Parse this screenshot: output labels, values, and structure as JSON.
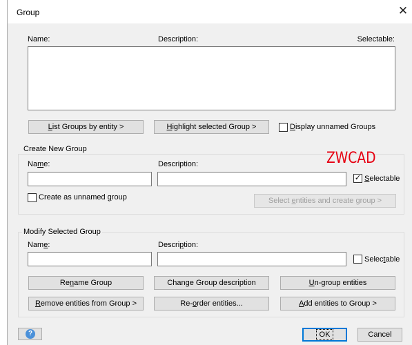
{
  "window": {
    "title": "Group",
    "close_glyph": "✕"
  },
  "groups_list": {
    "col_name": "Name:",
    "col_description": "Description:",
    "col_selectable": "Selectable:",
    "rows": []
  },
  "top_buttons": {
    "list_by_entity_pre": "",
    "list_by_entity_u": "L",
    "list_by_entity_post": "ist Groups by entity  >",
    "highlight_pre": "",
    "highlight_u": "H",
    "highlight_post": "ighlight selected Group  >",
    "display_unnamed_pre": "",
    "display_unnamed_u": "D",
    "display_unnamed_post": "isplay unnamed Groups",
    "display_unnamed_checked": false
  },
  "create_group": {
    "title": "Create New Group",
    "name_pre": "Na",
    "name_u": "m",
    "name_post": "e:",
    "description_label": "Description:",
    "name_value": "",
    "description_value": "",
    "selectable_pre": "",
    "selectable_u": "S",
    "selectable_post": "electable",
    "selectable_checked": true,
    "unnamed_pre": "Create as unnamed ",
    "unnamed_u": "g",
    "unnamed_post": "roup",
    "unnamed_checked": false,
    "select_entities_pre": "Select ",
    "select_entities_u": "e",
    "select_entities_post": "ntities and create group  >"
  },
  "watermark": "ZWCAD",
  "modify_group": {
    "title": "Modify Selected Group",
    "name_pre": "Nam",
    "name_u": "e",
    "name_post": ":",
    "description_pre": "Descri",
    "description_u": "p",
    "description_post": "tion:",
    "name_value": "",
    "description_value": "",
    "selectable_pre": "Selec",
    "selectable_u": "t",
    "selectable_post": "able",
    "selectable_checked": false,
    "rename_pre": "Re",
    "rename_u": "n",
    "rename_post": "ame Group",
    "change_desc_label": "Change Group description",
    "ungroup_pre": "",
    "ungroup_u": "U",
    "ungroup_post": "n-group entities",
    "remove_pre": "",
    "remove_u": "R",
    "remove_post": "emove entities from Group  >",
    "reorder_pre": "Re-",
    "reorder_u": "o",
    "reorder_post": "rder entities...",
    "add_pre": "",
    "add_u": "A",
    "add_post": "dd entities to Group  >"
  },
  "footer": {
    "help_icon": "question-mark-icon",
    "ok_label": "OK",
    "cancel_label": "Cancel"
  },
  "colors": {
    "accent": "#0078d7",
    "watermark": "#e60012",
    "help": "#4a90d9"
  }
}
